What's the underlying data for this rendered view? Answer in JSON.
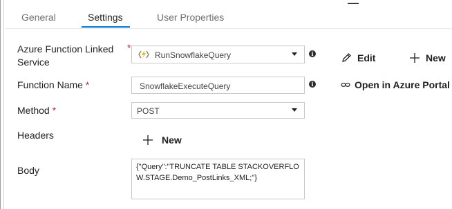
{
  "tabs": [
    {
      "label": "General"
    },
    {
      "label": "Settings"
    },
    {
      "label": "User Properties"
    }
  ],
  "active_tab": "Settings",
  "form": {
    "linked_service": {
      "label": "Azure Function Linked Service",
      "required": "*",
      "value": "RunSnowflakeQuery",
      "icon": "azure-function-icon"
    },
    "function_name": {
      "label": "Function Name",
      "required": "*",
      "value": "SnowflakeExecuteQuery"
    },
    "method": {
      "label": "Method",
      "required": "*",
      "value": "POST"
    },
    "headers": {
      "label": "Headers",
      "new_label": "New"
    },
    "body": {
      "label": "Body",
      "value": "{\"Query\":\"TRUNCATE TABLE STACKOVERFLOW.STAGE.Demo_PostLinks_XML;\"}"
    }
  },
  "actions": {
    "edit_label": "Edit",
    "new_label": "New",
    "open_portal_label": "Open in Azure Portal"
  },
  "colors": {
    "accent": "#0078d4",
    "required": "#c4262e",
    "function_icon": "#f5b700"
  }
}
